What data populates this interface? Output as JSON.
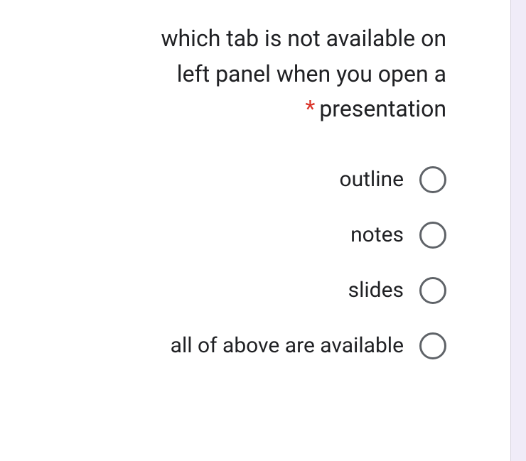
{
  "question": {
    "line1": "which tab is not available on",
    "line2": "left panel when you open a",
    "line3": "presentation",
    "required_marker": "*"
  },
  "options": [
    {
      "label": "outline"
    },
    {
      "label": "notes"
    },
    {
      "label": "slides"
    },
    {
      "label": "all of above are available"
    }
  ]
}
